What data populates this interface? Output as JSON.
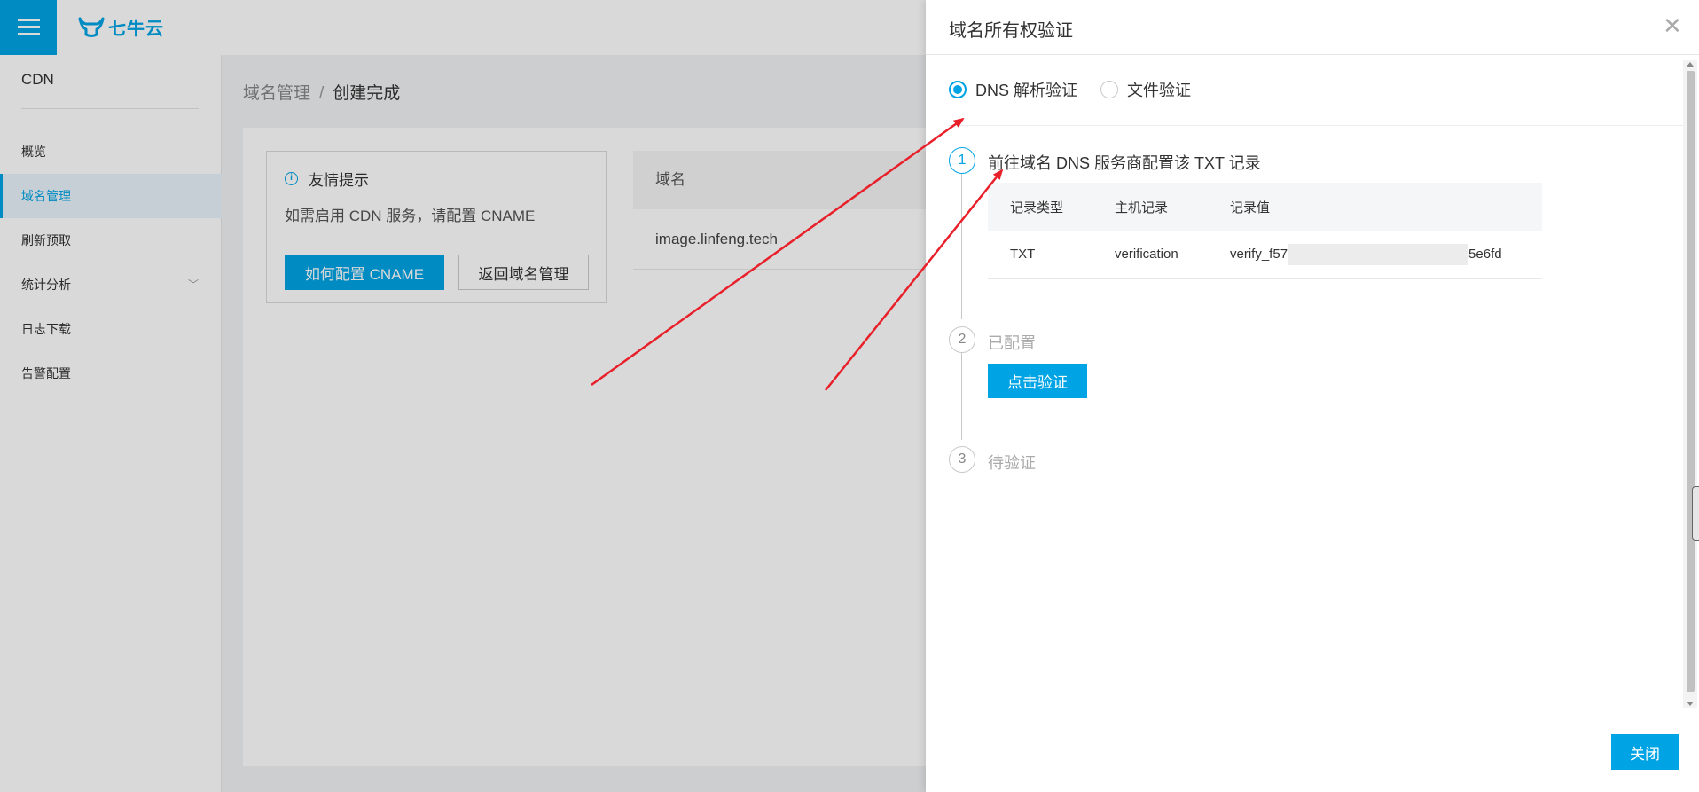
{
  "app": {
    "logo_text": "七牛云"
  },
  "sidebar": {
    "product": "CDN",
    "items": [
      {
        "label": "概览"
      },
      {
        "label": "域名管理"
      },
      {
        "label": "刷新预取"
      },
      {
        "label": "统计分析"
      },
      {
        "label": "日志下载"
      },
      {
        "label": "告警配置"
      }
    ],
    "active_index": 1
  },
  "breadcrumb": {
    "parent": "域名管理",
    "separator": "/",
    "current": "创建完成"
  },
  "tip": {
    "title": "友情提示",
    "text": "如需启用 CDN 服务，请配置 CNAME",
    "primary_button": "如何配置 CNAME",
    "secondary_button": "返回域名管理"
  },
  "domain_table": {
    "header": "域名",
    "rows": [
      "image.linfeng.tech"
    ]
  },
  "drawer": {
    "title": "域名所有权验证",
    "radio_options": [
      {
        "label": "DNS 解析验证",
        "checked": true
      },
      {
        "label": "文件验证",
        "checked": false
      }
    ],
    "steps": [
      {
        "number": "1",
        "title": "前往域名 DNS 服务商配置该 TXT 记录",
        "state": "active"
      },
      {
        "number": "2",
        "title": "已配置",
        "state": "pending"
      },
      {
        "number": "3",
        "title": "待验证",
        "state": "pending"
      }
    ],
    "record_table": {
      "headers": [
        "记录类型",
        "主机记录",
        "记录值"
      ],
      "row": {
        "type": "TXT",
        "host": "verification",
        "value_prefix": "verify_f57",
        "value_suffix": "5e6fd"
      }
    },
    "verify_button": "点击验证",
    "close_button": "关闭"
  },
  "colors": {
    "accent": "#00a4e4",
    "annotation_arrow": "#e8202a"
  }
}
